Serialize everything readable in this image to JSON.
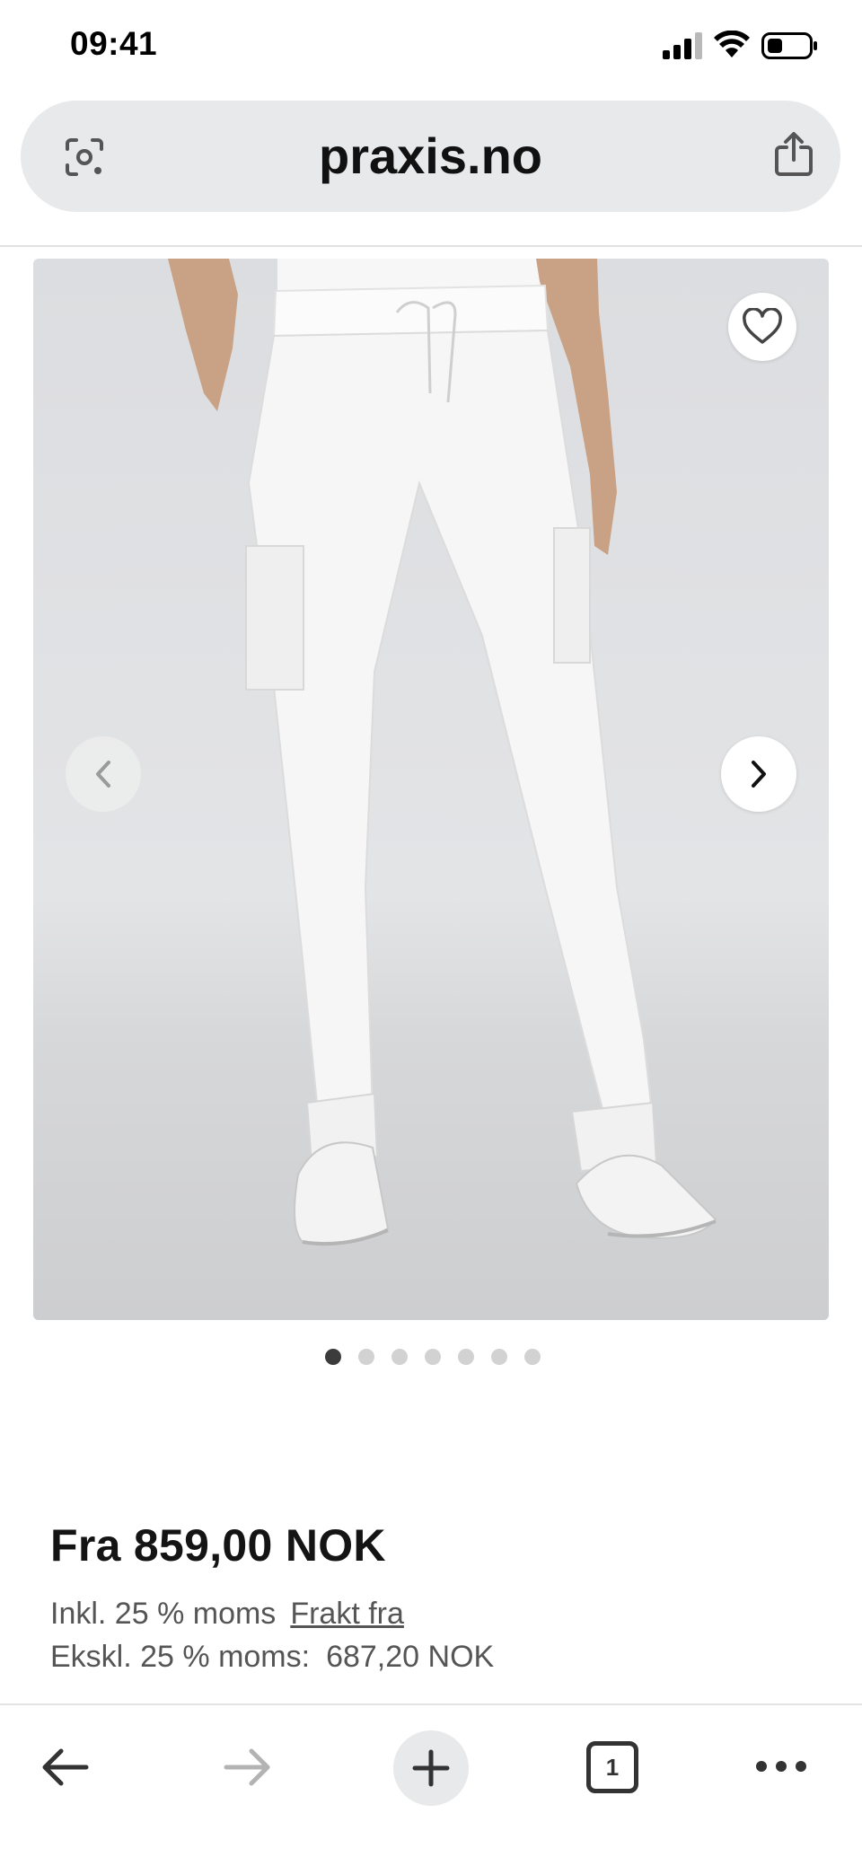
{
  "status_bar": {
    "time": "09:41"
  },
  "browser": {
    "url": "praxis.no"
  },
  "product": {
    "image_alt": "White jogger scrub pants",
    "carousel_total": 7,
    "carousel_active": 1
  },
  "pricing": {
    "price": "Fra 859,00 NOK",
    "vat_included": "Inkl. 25 % moms",
    "shipping_link": "Frakt fra",
    "vat_excluded_label": "Ekskl. 25 % moms:",
    "vat_excluded_value": "687,20 NOK"
  },
  "toolbar": {
    "tab_count": "1"
  },
  "icons": {
    "status": [
      "signal-icon",
      "wifi-icon",
      "battery-icon"
    ],
    "url_bar": [
      "lens-icon",
      "share-icon"
    ],
    "image": [
      "heart-icon",
      "chevron-left-icon",
      "chevron-right-icon"
    ],
    "toolbar": [
      "arrow-left-icon",
      "arrow-right-icon",
      "plus-icon",
      "tabs-icon",
      "more-icon"
    ]
  },
  "colors": {
    "accent_text": "#141414",
    "muted_text": "#555555",
    "url_bar_bg": "#e8e9ea",
    "dot_active": "#3c3c3c",
    "dot_inactive": "#d2d2d2"
  }
}
